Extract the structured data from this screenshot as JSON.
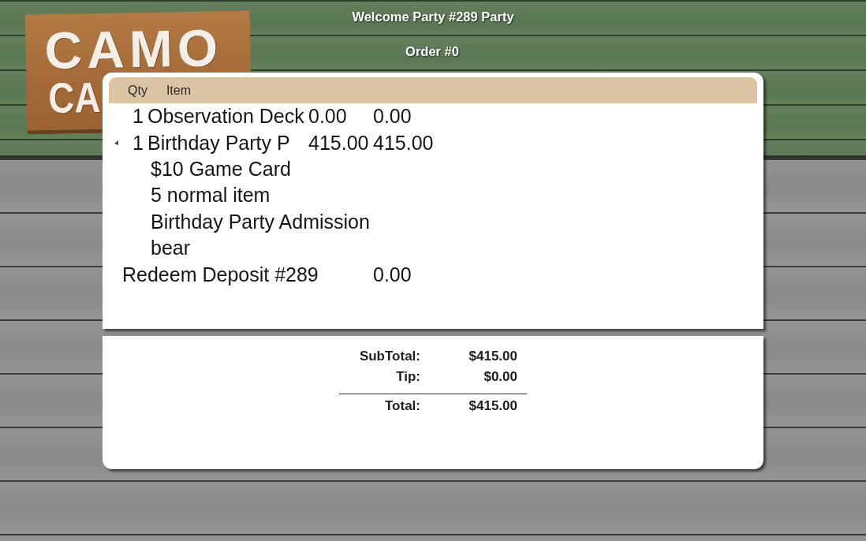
{
  "header": {
    "title": "Welcome Party #289 Party",
    "subtitle": "Order #0"
  },
  "logo": {
    "lines": [
      "CAMO",
      "CA"
    ]
  },
  "order_list": {
    "columns": [
      "Qty",
      "Item"
    ],
    "rows": [
      {
        "kind": "item",
        "qty": "1",
        "name": "Observation Deck",
        "price": "0.00",
        "total": "0.00",
        "expanded": false
      },
      {
        "kind": "item",
        "qty": "1",
        "name": "Birthday Party P",
        "price": "415.00",
        "total": "415.00",
        "expanded": true,
        "children": [
          "$10 Game Card",
          "5 normal item",
          "Birthday Party Admission",
          "bear"
        ]
      },
      {
        "kind": "deposit",
        "name": "Redeem Deposit #289",
        "amount": "0.00"
      }
    ]
  },
  "totals": [
    {
      "kind": "line",
      "label": "SubTotal:",
      "value": "$415.00"
    },
    {
      "kind": "line",
      "label": "Tip:",
      "value": "$0.00"
    },
    {
      "kind": "grand",
      "label": "Total:",
      "value": "$415.00"
    }
  ]
}
